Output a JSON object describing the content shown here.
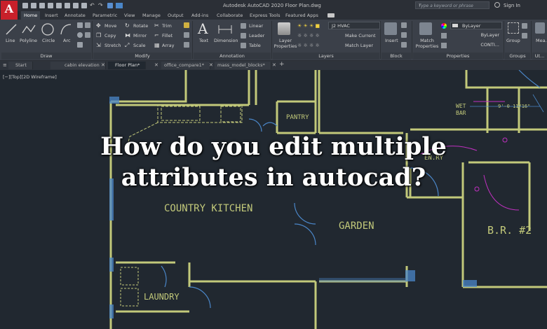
{
  "app": {
    "logo": "A",
    "title": "Autodesk AutoCAD 2020    Floor Plan.dwg",
    "search_placeholder": "Type a keyword or phrase",
    "sign_in": "Sign In"
  },
  "ribbon_tabs": [
    "Home",
    "Insert",
    "Annotate",
    "Parametric",
    "View",
    "Manage",
    "Output",
    "Add-ins",
    "Collaborate",
    "Express Tools",
    "Featured Apps"
  ],
  "ribbon": {
    "draw": {
      "line": "Line",
      "polyline": "Polyline",
      "circle": "Circle",
      "arc": "Arc",
      "group": "Draw"
    },
    "modify": {
      "move": "Move",
      "rotate": "Rotate",
      "trim": "Trim",
      "copy": "Copy",
      "mirror": "Mirror",
      "fillet": "Fillet",
      "stretch": "Stretch",
      "scale": "Scale",
      "array": "Array",
      "group": "Modify"
    },
    "annotation": {
      "text": "Text",
      "dimension": "Dimension",
      "linear": "Linear",
      "leader": "Leader",
      "table": "Table",
      "group": "Annotation"
    },
    "layers": {
      "properties": "Layer Properties",
      "current_layer": "J2 HVAC",
      "make_current": "Make Current",
      "match_layer": "Match Layer",
      "group": "Layers"
    },
    "block": {
      "insert": "Insert",
      "group": "Block"
    },
    "properties": {
      "match": "Match Properties",
      "color": "ByLayer",
      "linetype": "ByLayer",
      "lineweight": "CONTI...",
      "group": "Properties"
    },
    "groups": {
      "group_btn": "Group",
      "group": "Groups"
    },
    "utilities": {
      "measure": "Mea...",
      "group": "Ut..."
    }
  },
  "doc_tabs": [
    {
      "label": "Start",
      "active": false
    },
    {
      "label": "cabin elevation",
      "active": false
    },
    {
      "label": "Floor Plan*",
      "active": true
    },
    {
      "label": "office_compare1*",
      "active": false
    },
    {
      "label": "mass_model_blocks*",
      "active": false
    }
  ],
  "viewport_label": "[−][Top][2D Wireframe]",
  "drawing_labels": {
    "pantry": "PANTRY",
    "country_kitchen": "COUNTRY KITCHEN",
    "garden": "GARDEN",
    "br2": "B.R. #2",
    "laundry": "LAUNDRY",
    "wet_bar_1": "WET",
    "wet_bar_2": "BAR",
    "dimension": "9'-0 11/16\"",
    "entry": "EN.RY"
  },
  "headline": {
    "line1": "How do you edit multiple",
    "line2": "attributes in autocad?"
  },
  "colors": {
    "background": "#212830",
    "wall": "#c2c97a",
    "accent_blue": "#4a86c8",
    "magenta": "#c030c0",
    "logo_red": "#c8202a"
  }
}
